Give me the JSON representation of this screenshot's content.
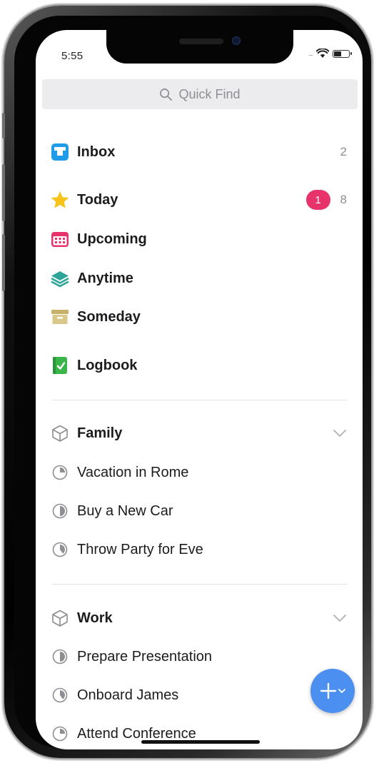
{
  "status_bar": {
    "time": "5:55",
    "signal": "....",
    "battery_level": 0.55
  },
  "search": {
    "placeholder": "Quick Find"
  },
  "lists": [
    {
      "id": "inbox",
      "label": "Inbox",
      "icon": "inbox-icon",
      "count": "2"
    },
    {
      "id": "today",
      "label": "Today",
      "icon": "star-icon",
      "badge": "1",
      "count": "8"
    },
    {
      "id": "upcoming",
      "label": "Upcoming",
      "icon": "calendar-icon"
    },
    {
      "id": "anytime",
      "label": "Anytime",
      "icon": "layers-icon"
    },
    {
      "id": "someday",
      "label": "Someday",
      "icon": "archive-box-icon"
    },
    {
      "id": "logbook",
      "label": "Logbook",
      "icon": "logbook-icon"
    }
  ],
  "areas": [
    {
      "label": "Family",
      "icon": "area-cube-icon",
      "projects": [
        {
          "label": "Vacation in Rome",
          "progress": 0.25
        },
        {
          "label": "Buy a New Car",
          "progress": 0.5
        },
        {
          "label": "Throw Party for Eve",
          "progress": 0.4
        }
      ]
    },
    {
      "label": "Work",
      "icon": "area-cube-icon",
      "projects": [
        {
          "label": "Prepare Presentation",
          "progress": 0.5
        },
        {
          "label": "Onboard James",
          "progress": 0.4
        },
        {
          "label": "Attend Conference",
          "progress": 0.25
        }
      ]
    }
  ],
  "colors": {
    "inbox": "#1e9be9",
    "today": "#f8c31b",
    "badge": "#e8336a",
    "upcoming": "#e8336a",
    "anytime": "#2fa59a",
    "someday": "#d3bf7c",
    "logbook": "#3ab54a",
    "fab": "#4b8ff0"
  },
  "fab": {
    "icon": "plus-icon"
  }
}
